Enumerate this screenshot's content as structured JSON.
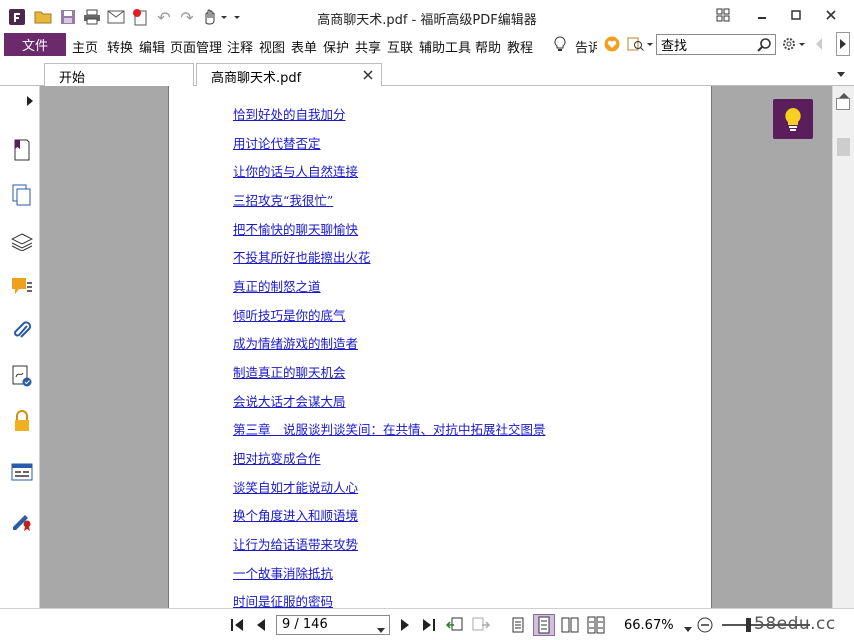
{
  "window": {
    "title": "高商聊天术.pdf - 福昕高级PDF编辑器"
  },
  "menu": {
    "file": "文件",
    "items": [
      "主页",
      "转换",
      "编辑",
      "页面管理",
      "注释",
      "视图",
      "表单",
      "保护",
      "共享",
      "互联",
      "辅助工具",
      "帮助",
      "教程"
    ],
    "tell_me": "告诉"
  },
  "search": {
    "value": "查找"
  },
  "tabs": [
    {
      "label": "开始"
    },
    {
      "label": "高商聊天术.pdf"
    }
  ],
  "document": {
    "toc": [
      "恰到好处的自我加分",
      "用讨论代替否定",
      "让你的话与人自然连接",
      "三招攻克“我很忙”",
      "把不愉快的聊天聊愉快",
      "不投其所好也能擦出火花",
      "真正的制怒之道",
      "倾听技巧是你的底气",
      "成为情绪游戏的制造者",
      "制造真正的聊天机会",
      "会说大话才会谋大局",
      "第三章　说服谈判谈笑间：在共情、对抗中拓展社交图景",
      "把对抗变成合作",
      "谈笑自如才能说动人心",
      "换个角度进入和顺语境",
      "让行为给话语带来攻势",
      "一个故事消除抵抗",
      "时间是征服的密码"
    ]
  },
  "status": {
    "page_indicator": "9 / 146",
    "zoom": "66.67%",
    "watermark": "58edu.cc"
  },
  "colors": {
    "accent": "#6b2a6b",
    "link": "#1a1ac8",
    "doc_bg": "#a8a8a8"
  }
}
